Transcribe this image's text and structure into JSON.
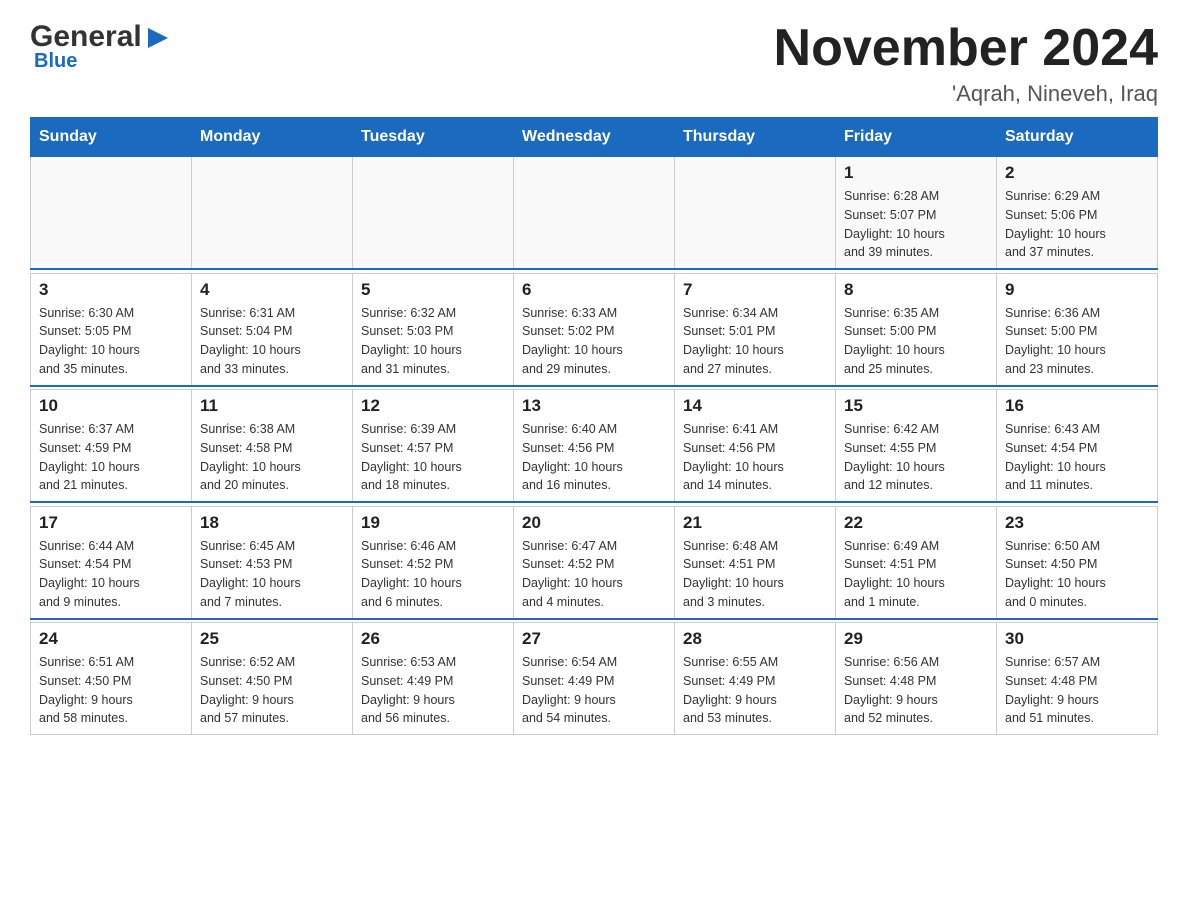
{
  "header": {
    "logo_text1": "General",
    "logo_text2": "Blue",
    "month": "November 2024",
    "location": "'Aqrah, Nineveh, Iraq"
  },
  "days_of_week": [
    "Sunday",
    "Monday",
    "Tuesday",
    "Wednesday",
    "Thursday",
    "Friday",
    "Saturday"
  ],
  "weeks": [
    {
      "days": [
        {
          "number": "",
          "info": ""
        },
        {
          "number": "",
          "info": ""
        },
        {
          "number": "",
          "info": ""
        },
        {
          "number": "",
          "info": ""
        },
        {
          "number": "",
          "info": ""
        },
        {
          "number": "1",
          "info": "Sunrise: 6:28 AM\nSunset: 5:07 PM\nDaylight: 10 hours\nand 39 minutes."
        },
        {
          "number": "2",
          "info": "Sunrise: 6:29 AM\nSunset: 5:06 PM\nDaylight: 10 hours\nand 37 minutes."
        }
      ]
    },
    {
      "days": [
        {
          "number": "3",
          "info": "Sunrise: 6:30 AM\nSunset: 5:05 PM\nDaylight: 10 hours\nand 35 minutes."
        },
        {
          "number": "4",
          "info": "Sunrise: 6:31 AM\nSunset: 5:04 PM\nDaylight: 10 hours\nand 33 minutes."
        },
        {
          "number": "5",
          "info": "Sunrise: 6:32 AM\nSunset: 5:03 PM\nDaylight: 10 hours\nand 31 minutes."
        },
        {
          "number": "6",
          "info": "Sunrise: 6:33 AM\nSunset: 5:02 PM\nDaylight: 10 hours\nand 29 minutes."
        },
        {
          "number": "7",
          "info": "Sunrise: 6:34 AM\nSunset: 5:01 PM\nDaylight: 10 hours\nand 27 minutes."
        },
        {
          "number": "8",
          "info": "Sunrise: 6:35 AM\nSunset: 5:00 PM\nDaylight: 10 hours\nand 25 minutes."
        },
        {
          "number": "9",
          "info": "Sunrise: 6:36 AM\nSunset: 5:00 PM\nDaylight: 10 hours\nand 23 minutes."
        }
      ]
    },
    {
      "days": [
        {
          "number": "10",
          "info": "Sunrise: 6:37 AM\nSunset: 4:59 PM\nDaylight: 10 hours\nand 21 minutes."
        },
        {
          "number": "11",
          "info": "Sunrise: 6:38 AM\nSunset: 4:58 PM\nDaylight: 10 hours\nand 20 minutes."
        },
        {
          "number": "12",
          "info": "Sunrise: 6:39 AM\nSunset: 4:57 PM\nDaylight: 10 hours\nand 18 minutes."
        },
        {
          "number": "13",
          "info": "Sunrise: 6:40 AM\nSunset: 4:56 PM\nDaylight: 10 hours\nand 16 minutes."
        },
        {
          "number": "14",
          "info": "Sunrise: 6:41 AM\nSunset: 4:56 PM\nDaylight: 10 hours\nand 14 minutes."
        },
        {
          "number": "15",
          "info": "Sunrise: 6:42 AM\nSunset: 4:55 PM\nDaylight: 10 hours\nand 12 minutes."
        },
        {
          "number": "16",
          "info": "Sunrise: 6:43 AM\nSunset: 4:54 PM\nDaylight: 10 hours\nand 11 minutes."
        }
      ]
    },
    {
      "days": [
        {
          "number": "17",
          "info": "Sunrise: 6:44 AM\nSunset: 4:54 PM\nDaylight: 10 hours\nand 9 minutes."
        },
        {
          "number": "18",
          "info": "Sunrise: 6:45 AM\nSunset: 4:53 PM\nDaylight: 10 hours\nand 7 minutes."
        },
        {
          "number": "19",
          "info": "Sunrise: 6:46 AM\nSunset: 4:52 PM\nDaylight: 10 hours\nand 6 minutes."
        },
        {
          "number": "20",
          "info": "Sunrise: 6:47 AM\nSunset: 4:52 PM\nDaylight: 10 hours\nand 4 minutes."
        },
        {
          "number": "21",
          "info": "Sunrise: 6:48 AM\nSunset: 4:51 PM\nDaylight: 10 hours\nand 3 minutes."
        },
        {
          "number": "22",
          "info": "Sunrise: 6:49 AM\nSunset: 4:51 PM\nDaylight: 10 hours\nand 1 minute."
        },
        {
          "number": "23",
          "info": "Sunrise: 6:50 AM\nSunset: 4:50 PM\nDaylight: 10 hours\nand 0 minutes."
        }
      ]
    },
    {
      "days": [
        {
          "number": "24",
          "info": "Sunrise: 6:51 AM\nSunset: 4:50 PM\nDaylight: 9 hours\nand 58 minutes."
        },
        {
          "number": "25",
          "info": "Sunrise: 6:52 AM\nSunset: 4:50 PM\nDaylight: 9 hours\nand 57 minutes."
        },
        {
          "number": "26",
          "info": "Sunrise: 6:53 AM\nSunset: 4:49 PM\nDaylight: 9 hours\nand 56 minutes."
        },
        {
          "number": "27",
          "info": "Sunrise: 6:54 AM\nSunset: 4:49 PM\nDaylight: 9 hours\nand 54 minutes."
        },
        {
          "number": "28",
          "info": "Sunrise: 6:55 AM\nSunset: 4:49 PM\nDaylight: 9 hours\nand 53 minutes."
        },
        {
          "number": "29",
          "info": "Sunrise: 6:56 AM\nSunset: 4:48 PM\nDaylight: 9 hours\nand 52 minutes."
        },
        {
          "number": "30",
          "info": "Sunrise: 6:57 AM\nSunset: 4:48 PM\nDaylight: 9 hours\nand 51 minutes."
        }
      ]
    }
  ]
}
